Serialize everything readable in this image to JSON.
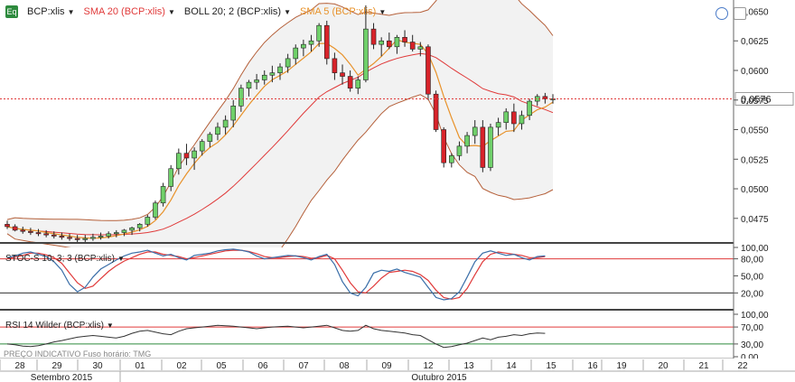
{
  "toolbar": {
    "symbol": "BCP:xlis",
    "logo_text": "Eq",
    "sma20": "SMA 20 (BCP:xlis)",
    "boll": "BOLL 20; 2 (BCP:xlis)",
    "sma5": "SMA 5 (BCP:xlis)",
    "sma20_color": "#e03a3a",
    "sma5_color": "#e8922a"
  },
  "panels": {
    "stoch_label": "STOC-S 10; 3; 3 (BCP:xlis)",
    "rsi_label": "RSI 14 Wilder (BCP:xlis)",
    "footer_note": "PREÇO INDICATIVO    Fuso horário: TMG"
  },
  "chart_data": [
    {
      "type": "candlestick",
      "symbol": "BCP:xlis",
      "y_ticks": [
        "0,0650",
        "0,0625",
        "0,0600",
        "0,0575",
        "0,0550",
        "0,0525",
        "0,0500",
        "0,0475"
      ],
      "ylim": [
        0.0455,
        0.0658
      ],
      "last_price": "0,0576",
      "ohlc": [
        [
          0.047,
          0.0473,
          0.0466,
          0.0468
        ],
        [
          0.0468,
          0.047,
          0.0464,
          0.0465
        ],
        [
          0.0465,
          0.0468,
          0.0462,
          0.0464
        ],
        [
          0.0464,
          0.0467,
          0.0461,
          0.0463
        ],
        [
          0.0463,
          0.0466,
          0.046,
          0.0462
        ],
        [
          0.0462,
          0.0465,
          0.0459,
          0.0461
        ],
        [
          0.0461,
          0.0464,
          0.0458,
          0.046
        ],
        [
          0.046,
          0.0463,
          0.0457,
          0.0459
        ],
        [
          0.0459,
          0.0462,
          0.0456,
          0.0458
        ],
        [
          0.0458,
          0.0461,
          0.0455,
          0.0457
        ],
        [
          0.0457,
          0.0461,
          0.0455,
          0.0458
        ],
        [
          0.0458,
          0.0462,
          0.0456,
          0.0459
        ],
        [
          0.0459,
          0.0463,
          0.0457,
          0.046
        ],
        [
          0.046,
          0.0464,
          0.0458,
          0.0462
        ],
        [
          0.0462,
          0.0465,
          0.0459,
          0.0463
        ],
        [
          0.0463,
          0.0466,
          0.046,
          0.0465
        ],
        [
          0.0465,
          0.0468,
          0.0461,
          0.0467
        ],
        [
          0.0467,
          0.0471,
          0.0464,
          0.047
        ],
        [
          0.047,
          0.0478,
          0.0468,
          0.0476
        ],
        [
          0.0476,
          0.049,
          0.0474,
          0.0488
        ],
        [
          0.0488,
          0.0505,
          0.0485,
          0.0502
        ],
        [
          0.0502,
          0.052,
          0.0498,
          0.0517
        ],
        [
          0.0517,
          0.0534,
          0.0512,
          0.053
        ],
        [
          0.053,
          0.0538,
          0.052,
          0.0526
        ],
        [
          0.0526,
          0.0535,
          0.0516,
          0.0532
        ],
        [
          0.0532,
          0.0542,
          0.0528,
          0.054
        ],
        [
          0.054,
          0.0548,
          0.0535,
          0.0546
        ],
        [
          0.0546,
          0.0556,
          0.0541,
          0.0552
        ],
        [
          0.0552,
          0.0562,
          0.0546,
          0.0558
        ],
        [
          0.0558,
          0.0575,
          0.0552,
          0.057
        ],
        [
          0.057,
          0.0588,
          0.0565,
          0.0585
        ],
        [
          0.0585,
          0.0592,
          0.0578,
          0.059
        ],
        [
          0.059,
          0.0597,
          0.0584,
          0.0592
        ],
        [
          0.0592,
          0.06,
          0.0588,
          0.0596
        ],
        [
          0.0596,
          0.0604,
          0.059,
          0.0598
        ],
        [
          0.0598,
          0.0606,
          0.0592,
          0.0603
        ],
        [
          0.0603,
          0.0614,
          0.0598,
          0.061
        ],
        [
          0.061,
          0.0622,
          0.0605,
          0.0619
        ],
        [
          0.0619,
          0.0626,
          0.0612,
          0.0622
        ],
        [
          0.0622,
          0.063,
          0.0616,
          0.0625
        ],
        [
          0.0625,
          0.064,
          0.062,
          0.0638
        ],
        [
          0.0638,
          0.0642,
          0.0605,
          0.061
        ],
        [
          0.061,
          0.0615,
          0.0592,
          0.0598
        ],
        [
          0.0598,
          0.0605,
          0.0588,
          0.0595
        ],
        [
          0.0595,
          0.06,
          0.0582,
          0.0585
        ],
        [
          0.0585,
          0.0595,
          0.058,
          0.0592
        ],
        [
          0.0592,
          0.0655,
          0.059,
          0.0635
        ],
        [
          0.0635,
          0.064,
          0.0618,
          0.0622
        ],
        [
          0.0622,
          0.0628,
          0.0612,
          0.0625
        ],
        [
          0.0625,
          0.0632,
          0.0618,
          0.062
        ],
        [
          0.062,
          0.063,
          0.0614,
          0.0628
        ],
        [
          0.0628,
          0.0634,
          0.062,
          0.0624
        ],
        [
          0.0624,
          0.063,
          0.0616,
          0.0618
        ],
        [
          0.0618,
          0.0624,
          0.0612,
          0.062
        ],
        [
          0.062,
          0.0622,
          0.0575,
          0.058
        ],
        [
          0.058,
          0.0583,
          0.0548,
          0.055
        ],
        [
          0.055,
          0.0552,
          0.0518,
          0.0522
        ],
        [
          0.0522,
          0.053,
          0.0518,
          0.0528
        ],
        [
          0.0528,
          0.054,
          0.0524,
          0.0536
        ],
        [
          0.0536,
          0.0548,
          0.053,
          0.0545
        ],
        [
          0.0545,
          0.0558,
          0.0538,
          0.0552
        ],
        [
          0.0552,
          0.0558,
          0.0514,
          0.0518
        ],
        [
          0.0518,
          0.0555,
          0.0515,
          0.0552
        ],
        [
          0.0552,
          0.056,
          0.0545,
          0.0556
        ],
        [
          0.0556,
          0.0568,
          0.055,
          0.0565
        ],
        [
          0.0565,
          0.0572,
          0.0548,
          0.0555
        ],
        [
          0.0555,
          0.0566,
          0.055,
          0.0562
        ],
        [
          0.0562,
          0.0576,
          0.0558,
          0.0574
        ],
        [
          0.0574,
          0.058,
          0.057,
          0.0578
        ],
        [
          0.0578,
          0.0581,
          0.0572,
          0.0576
        ],
        [
          0.0576,
          0.058,
          0.0572,
          0.0576
        ]
      ]
    },
    {
      "type": "line",
      "name": "STOC-S 10; 3; 3 (BCP:xlis)",
      "y_ticks": [
        "100,00",
        "80,00",
        "50,00",
        "20,00"
      ],
      "ylim": [
        0,
        100
      ],
      "levels": [
        80,
        20
      ],
      "k": [
        82,
        85,
        90,
        92,
        88,
        84,
        75,
        60,
        35,
        22,
        30,
        48,
        62,
        70,
        78,
        85,
        90,
        92,
        95,
        90,
        85,
        88,
        82,
        78,
        86,
        88,
        90,
        94,
        96,
        97,
        95,
        92,
        85,
        80,
        82,
        84,
        86,
        85,
        82,
        78,
        84,
        88,
        70,
        40,
        20,
        15,
        30,
        55,
        60,
        58,
        62,
        56,
        52,
        48,
        30,
        12,
        8,
        10,
        22,
        48,
        75,
        90,
        94,
        90,
        86,
        88,
        82,
        78,
        84,
        85
      ],
      "d": [
        80,
        83,
        86,
        90,
        90,
        87,
        82,
        72,
        55,
        38,
        28,
        32,
        45,
        58,
        68,
        76,
        82,
        88,
        92,
        92,
        88,
        86,
        84,
        80,
        82,
        85,
        88,
        91,
        94,
        95,
        95,
        93,
        89,
        84,
        82,
        82,
        84,
        85,
        84,
        81,
        82,
        86,
        80,
        60,
        38,
        22,
        20,
        32,
        46,
        56,
        58,
        60,
        58,
        52,
        42,
        25,
        12,
        9,
        12,
        28,
        52,
        75,
        88,
        92,
        90,
        88,
        86,
        82,
        82,
        84
      ]
    },
    {
      "type": "line",
      "name": "RSI 14 Wilder (BCP:xlis)",
      "y_ticks": [
        "100,00",
        "70,00",
        "30,00",
        "0,00"
      ],
      "ylim": [
        0,
        100
      ],
      "levels": [
        70,
        30
      ],
      "values": [
        30,
        28,
        25,
        24,
        26,
        30,
        35,
        38,
        42,
        46,
        48,
        50,
        48,
        46,
        44,
        48,
        55,
        60,
        62,
        58,
        54,
        52,
        60,
        66,
        68,
        70,
        72,
        74,
        73,
        72,
        70,
        68,
        66,
        68,
        70,
        71,
        72,
        70,
        68,
        70,
        72,
        74,
        68,
        62,
        60,
        62,
        74,
        66,
        62,
        60,
        58,
        56,
        52,
        50,
        40,
        30,
        22,
        24,
        28,
        32,
        38,
        44,
        40,
        46,
        48,
        52,
        50,
        54,
        56,
        55
      ]
    }
  ],
  "x_axis": {
    "days": [
      "28",
      "29",
      "30",
      "01",
      "02",
      "05",
      "06",
      "07",
      "08",
      "09",
      "12",
      "13",
      "14",
      "15",
      "16",
      "19",
      "20",
      "21",
      "22"
    ],
    "months": [
      "Setembro 2015",
      "Outubro 2015"
    ]
  }
}
